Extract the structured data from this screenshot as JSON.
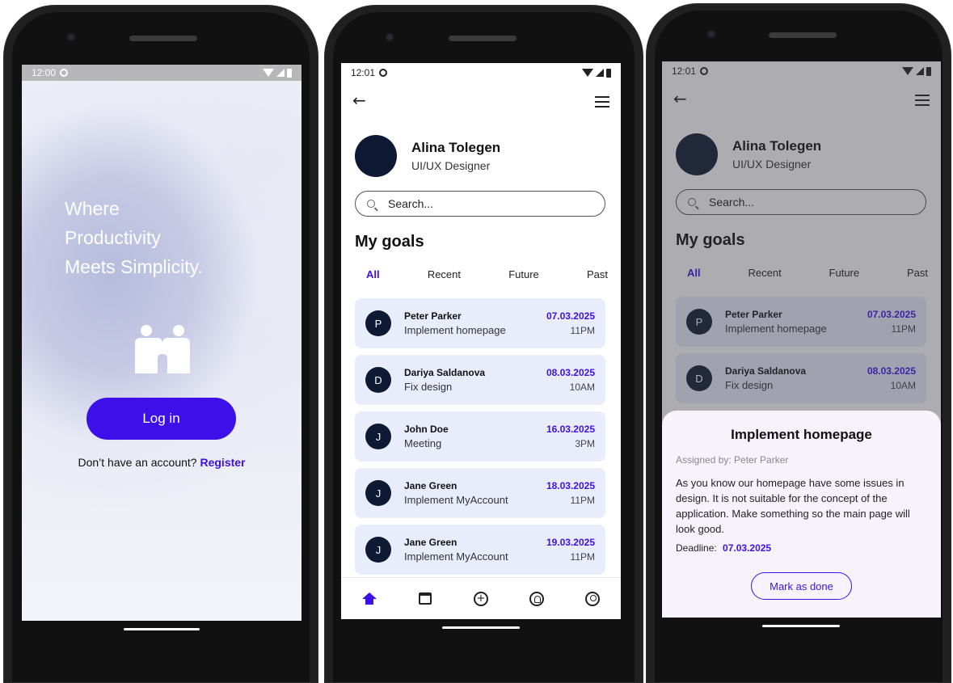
{
  "colors": {
    "accent": "#3d10ea",
    "card_bg": "#e9edfb",
    "avatar": "#0e1a33",
    "sheet_bg": "#f7f3fd"
  },
  "screen1": {
    "status_time": "12:00",
    "tagline": [
      "Where",
      "Productivity",
      "Meets Simplicity."
    ],
    "login_label": "Log in",
    "register_prompt": "Don’t have an account?",
    "register_label": "Register"
  },
  "screen2": {
    "status_time": "12:01",
    "profile": {
      "name": "Alina Tolegen",
      "role": "UI/UX Designer"
    },
    "search_placeholder": "Search...",
    "section_title": "My goals",
    "tabs": [
      "All",
      "Recent",
      "Future",
      "Past"
    ],
    "goals": [
      {
        "initial": "P",
        "name": "Peter Parker",
        "task": "Implement homepage",
        "date": "07.03.2025",
        "time": "11PM"
      },
      {
        "initial": "D",
        "name": "Dariya Saldanova",
        "task": "Fix design",
        "date": "08.03.2025",
        "time": "10AM"
      },
      {
        "initial": "J",
        "name": "John Doe",
        "task": "Meeting",
        "date": "16.03.2025",
        "time": "3PM"
      },
      {
        "initial": "J",
        "name": "Jane Green",
        "task": "Implement MyAccount",
        "date": "18.03.2025",
        "time": "11PM"
      },
      {
        "initial": "J",
        "name": "Jane Green",
        "task": "Implement MyAccount",
        "date": "19.03.2025",
        "time": "11PM"
      }
    ],
    "nav_icons": [
      "home-icon",
      "calendar-icon",
      "add-icon",
      "notifications-icon",
      "profile-icon"
    ]
  },
  "screen3": {
    "status_time": "12:01",
    "profile": {
      "name": "Alina Tolegen",
      "role": "UI/UX Designer"
    },
    "search_placeholder": "Search...",
    "section_title": "My goals",
    "tabs": [
      "All",
      "Recent",
      "Future",
      "Past"
    ],
    "goals": [
      {
        "initial": "P",
        "name": "Peter Parker",
        "task": "Implement homepage",
        "date": "07.03.2025",
        "time": "11PM"
      },
      {
        "initial": "D",
        "name": "Dariya Saldanova",
        "task": "Fix design",
        "date": "08.03.2025",
        "time": "10AM"
      }
    ],
    "sheet": {
      "title": "Implement homepage",
      "assigned": "Assigned by: Peter Parker",
      "description": "As you know our homepage have some issues in design. It is not suitable for the concept of the application. Make something so the main page will look good.",
      "deadline_label": "Deadline:",
      "deadline_value": "07.03.2025",
      "action_label": "Mark as done"
    }
  }
}
